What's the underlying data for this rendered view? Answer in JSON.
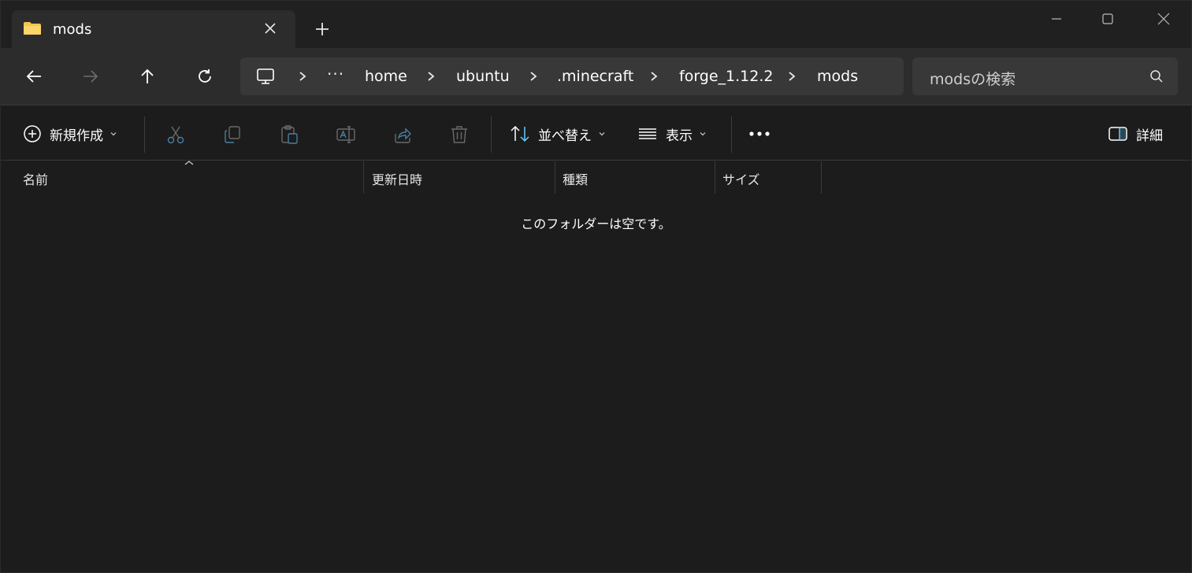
{
  "tab": {
    "title": "mods",
    "folder_icon": "folder-icon",
    "close_icon": "close-icon"
  },
  "new_tab_icon": "plus-icon",
  "window_controls": {
    "minimize_icon": "minimize-icon",
    "maximize_icon": "maximize-icon",
    "close_icon": "close-icon"
  },
  "nav": {
    "back_icon": "arrow-left-icon",
    "forward_icon": "arrow-right-icon",
    "up_icon": "arrow-up-icon",
    "refresh_icon": "refresh-icon"
  },
  "address": {
    "root_icon": "computer-icon",
    "more_label": "···",
    "crumbs": [
      "home",
      "ubuntu",
      ".minecraft",
      "forge_1.12.2",
      "mods"
    ]
  },
  "search": {
    "placeholder": "modsの検索",
    "icon": "search-icon"
  },
  "commands": {
    "new": "新規作成",
    "sort": "並べ替え",
    "view": "表示",
    "details": "詳細",
    "more_label": "•••"
  },
  "columns": [
    "名前",
    "更新日時",
    "種類",
    "サイズ"
  ],
  "empty_message": "このフォルダーは空です。",
  "colors": {
    "accent": "#60cdff",
    "bg": "#1c1c1c",
    "toolbar": "#2c2c2c",
    "field": "#383838",
    "disabled_icon": "#6a6a6a",
    "folder": "#f8c54a"
  }
}
